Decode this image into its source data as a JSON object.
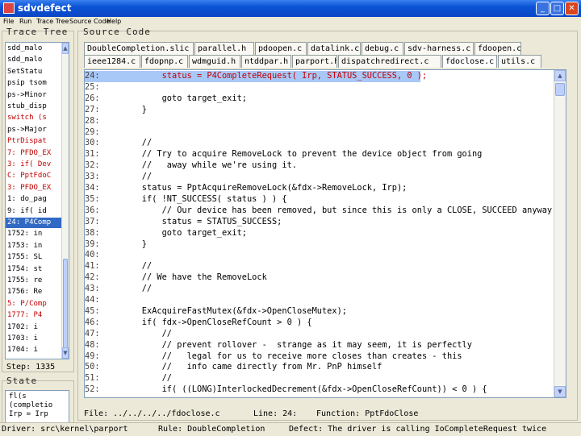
{
  "window": {
    "title": "sdvdefect",
    "min": "_",
    "max": "□",
    "close": "✕"
  },
  "menu": [
    "File",
    "Run",
    "Trace Tree",
    "Source Code",
    "Help"
  ],
  "trace_tree": {
    "title": "Trace Tree",
    "rows": [
      {
        "text": "sdd_malo",
        "color": "#000"
      },
      {
        "text": "sdd_malo",
        "color": "#000"
      },
      {
        "text": "SetStatu",
        "color": "#000"
      },
      {
        "text": "psip tsom",
        "color": "#000"
      },
      {
        "text": "ps->Minor",
        "color": "#000"
      },
      {
        "text": "stub_disp",
        "color": "#000"
      },
      {
        "text": "switch (s",
        "color": "#c00000"
      },
      {
        "text": "ps->Major",
        "color": "#000"
      },
      {
        "text": "PtrDispat",
        "color": "#c00000"
      },
      {
        "text": "7: PFDO_EX",
        "color": "#c00000"
      },
      {
        "text": "3: if( Dev",
        "color": "#c00000"
      },
      {
        "text": "C: PptFdoC",
        "color": "#c00000"
      },
      {
        "text": "3: PFDO_EX",
        "color": "#c00000"
      },
      {
        "text": "1: do_pag",
        "color": "#000"
      },
      {
        "text": "9: if( id",
        "color": "#000"
      },
      {
        "text": "24: P4Comp",
        "color": "#fff",
        "selected": true
      },
      {
        "text": "1752: in",
        "color": "#000"
      },
      {
        "text": "1753: in",
        "color": "#000"
      },
      {
        "text": "1755: SL",
        "color": "#000"
      },
      {
        "text": "1754: st",
        "color": "#000"
      },
      {
        "text": "1755: re",
        "color": "#000"
      },
      {
        "text": "1756: Re",
        "color": "#000"
      },
      {
        "text": "5: P/Comp",
        "color": "#c00000"
      },
      {
        "text": "1777: P4",
        "color": "#c00000"
      },
      {
        "text": "1702: i",
        "color": "#000"
      },
      {
        "text": "1703: i",
        "color": "#000"
      },
      {
        "text": "1704: i",
        "color": "#000"
      }
    ]
  },
  "step_label": "Step: 1335",
  "state": {
    "title": "State",
    "lines": [
      "fl(s",
      "(completio",
      "Irp = Irp"
    ]
  },
  "source": {
    "title": "Source Code",
    "tabs_row1": [
      "DoubleCompletion.slic",
      "parallel.h",
      "pdoopen.c",
      "datalink.c",
      "debug.c",
      "sdv-harness.c",
      "fdoopen.c"
    ],
    "tabs_row2": [
      "ieee1284.c",
      "fdopnp.c",
      "wdmguid.h",
      "ntddpar.h",
      "parport.h",
      "dispatchredirect.c",
      "fdoclose.c",
      "utils.c"
    ],
    "lines": [
      {
        "n": "24:",
        "t": "        status = P4CompleteRequest( Irp, STATUS_SUCCESS, 0 );",
        "hl": true
      },
      {
        "n": "25:",
        "t": ""
      },
      {
        "n": "26:",
        "t": "        goto target_exit;"
      },
      {
        "n": "27:",
        "t": "    }"
      },
      {
        "n": "28:",
        "t": ""
      },
      {
        "n": "29:",
        "t": ""
      },
      {
        "n": "30:",
        "t": "    //"
      },
      {
        "n": "31:",
        "t": "    // Try to acquire RemoveLock to prevent the device object from going"
      },
      {
        "n": "32:",
        "t": "    //   away while we're using it."
      },
      {
        "n": "33:",
        "t": "    //"
      },
      {
        "n": "34:",
        "t": "    status = PptAcquireRemoveLock(&fdx->RemoveLock, Irp);"
      },
      {
        "n": "35:",
        "t": "    if( !NT_SUCCESS( status ) ) {"
      },
      {
        "n": "36:",
        "t": "        // Our device has been removed, but since this is only a CLOSE, SUCCEED anyway."
      },
      {
        "n": "37:",
        "t": "        status = STATUS_SUCCESS;"
      },
      {
        "n": "38:",
        "t": "        goto target_exit;"
      },
      {
        "n": "39:",
        "t": "    }"
      },
      {
        "n": "40:",
        "t": ""
      },
      {
        "n": "41:",
        "t": "    //"
      },
      {
        "n": "42:",
        "t": "    // We have the RemoveLock"
      },
      {
        "n": "43:",
        "t": "    //"
      },
      {
        "n": "44:",
        "t": ""
      },
      {
        "n": "45:",
        "t": "    ExAcquireFastMutex(&fdx->OpenCloseMutex);"
      },
      {
        "n": "46:",
        "t": "    if( fdx->OpenCloseRefCount > 0 ) {"
      },
      {
        "n": "47:",
        "t": "        //"
      },
      {
        "n": "48:",
        "t": "        // prevent rollover -  strange as it may seem, it is perfectly"
      },
      {
        "n": "49:",
        "t": "        //   legal for us to receive more closes than creates - this"
      },
      {
        "n": "50:",
        "t": "        //   info came directly from Mr. PnP himself"
      },
      {
        "n": "51:",
        "t": "        //"
      },
      {
        "n": "52:",
        "t": "        if( ((LONG)InterlockedDecrement(&fdx->OpenCloseRefCount)) < 0 ) {"
      }
    ]
  },
  "file_status": {
    "file": "File: ../../../../fdoclose.c",
    "line": "Line: 24:",
    "function": "Function: PptFdoClose"
  },
  "bottom_status": {
    "driver": "Driver: src\\kernel\\parport",
    "rule": "Rule: DoubleCompletion",
    "defect": "Defect: The driver is calling IoCompleteRequest twice"
  }
}
